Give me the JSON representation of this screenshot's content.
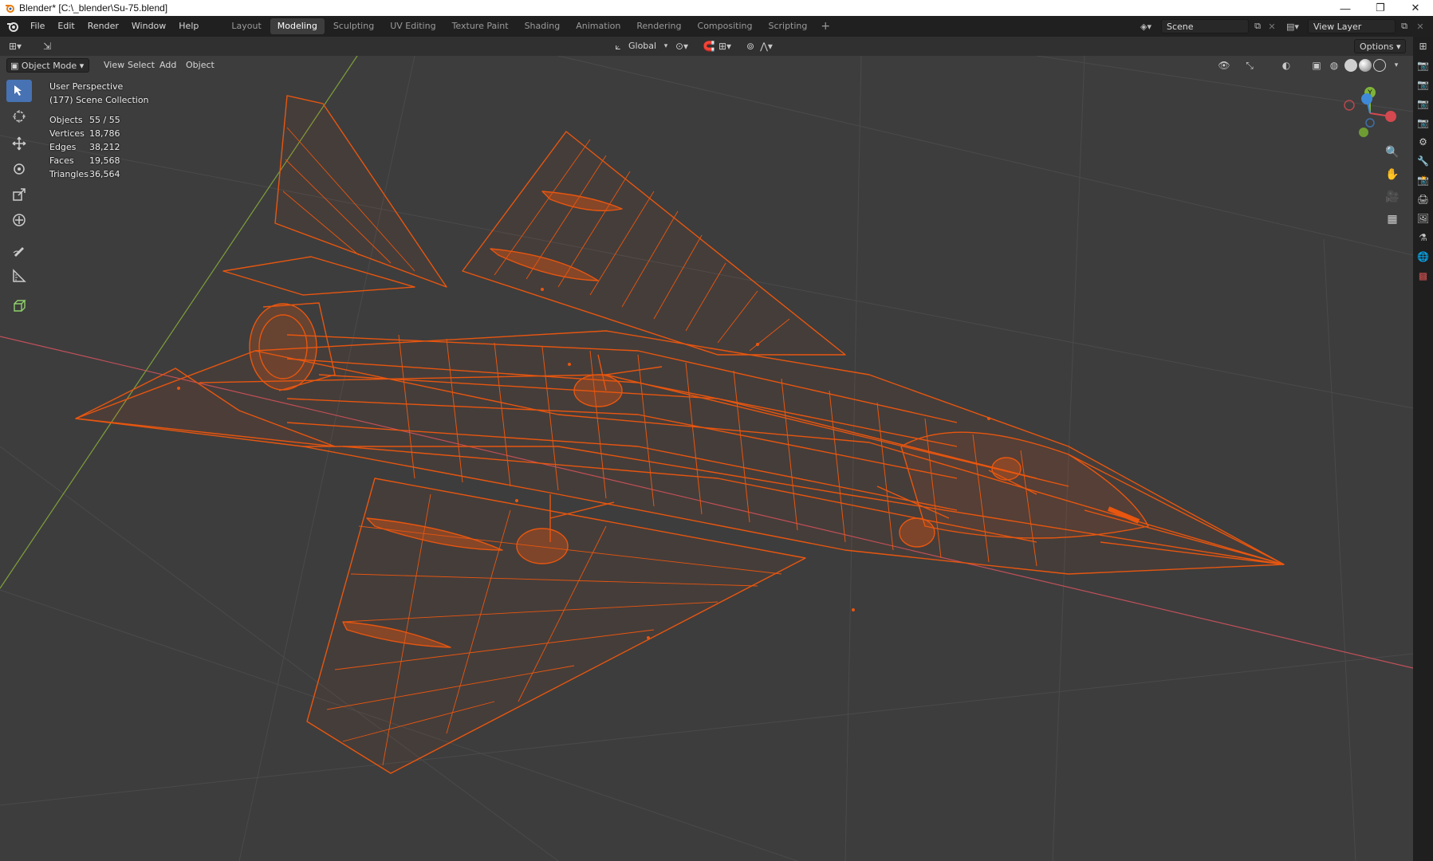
{
  "window": {
    "title": "Blender* [C:\\_blender\\Su-75.blend]",
    "minimize": "—",
    "restore": "❐",
    "close": "✕"
  },
  "menu": [
    "File",
    "Edit",
    "Render",
    "Window",
    "Help"
  ],
  "workspaces": [
    "Layout",
    "Modeling",
    "Sculpting",
    "UV Editing",
    "Texture Paint",
    "Shading",
    "Animation",
    "Rendering",
    "Compositing",
    "Scripting"
  ],
  "active_workspace": "Modeling",
  "scene": {
    "label": "Scene",
    "view_layer": "View Layer"
  },
  "tool_header": {
    "orientation": "Global",
    "options": "Options"
  },
  "viewport_header": {
    "mode": "Object Mode",
    "menus": [
      "View",
      "Select",
      "Add",
      "Object"
    ]
  },
  "overlay": {
    "perspective": "User Perspective",
    "collection": "(177) Scene Collection",
    "stats": [
      {
        "label": "Objects",
        "value": "55 / 55"
      },
      {
        "label": "Vertices",
        "value": "18,786"
      },
      {
        "label": "Edges",
        "value": "38,212"
      },
      {
        "label": "Faces",
        "value": "19,568"
      },
      {
        "label": "Triangles",
        "value": "36,564"
      }
    ]
  },
  "gizmo": {
    "y": "Y"
  },
  "colors": {
    "wire": "#e8560f",
    "x_axis": "#d4484f",
    "y_axis": "#7fb33a",
    "z_axis": "#3f8ad8",
    "active_tool": "#4772b3"
  }
}
